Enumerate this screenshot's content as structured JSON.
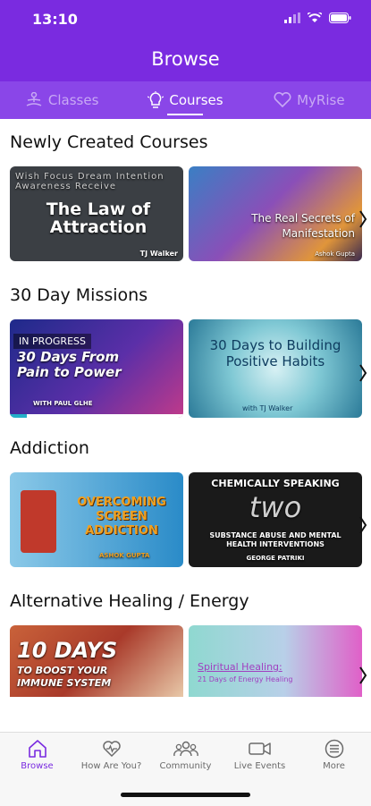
{
  "status": {
    "time": "13:10"
  },
  "header": {
    "title": "Browse"
  },
  "tabs": [
    {
      "label": "Classes",
      "icon": "meditation-icon"
    },
    {
      "label": "Courses",
      "icon": "lightbulb-icon"
    },
    {
      "label": "MyRise",
      "icon": "heart-icon"
    }
  ],
  "sections": [
    {
      "title": "Newly Created Courses",
      "cards": [
        {
          "title": "The Law of Attraction",
          "author": "TJ Walker",
          "extra_words": "Wish Focus Dream Intention Awareness Receive"
        },
        {
          "title": "The Real Secrets of Manifestation",
          "author": "Ashok Gupta"
        }
      ]
    },
    {
      "title": "30 Day Missions",
      "cards": [
        {
          "badge": "IN PROGRESS",
          "title": "30 Days From Pain to Power",
          "author": "WITH PAUL GLHE",
          "progress": 0.1
        },
        {
          "title": "30 Days to Building Positive Habits",
          "author": "with TJ Walker"
        }
      ]
    },
    {
      "title": "Addiction",
      "cards": [
        {
          "title": "OVERCOMING SCREEN ADDICTION",
          "author": "ASHOK GUPTA"
        },
        {
          "title": "CHEMICALLY SPEAKING",
          "subtitle": "two",
          "text2": "SUBSTANCE ABUSE AND MENTAL HEALTH INTERVENTIONS",
          "author": "GEORGE PATRIKI"
        }
      ]
    },
    {
      "title": "Alternative Healing / Energy",
      "cards": [
        {
          "title": "10 DAYS",
          "subtitle": "TO BOOST YOUR IMMUNE SYSTEM"
        },
        {
          "title": "Spiritual Healing:",
          "subtitle": "21 Days of Energy Healing"
        }
      ]
    }
  ],
  "bottom_nav": [
    {
      "label": "Browse",
      "icon": "home-icon"
    },
    {
      "label": "How Are You?",
      "icon": "heart-pulse-icon"
    },
    {
      "label": "Community",
      "icon": "community-icon"
    },
    {
      "label": "Live Events",
      "icon": "video-camera-icon"
    },
    {
      "label": "More",
      "icon": "more-icon"
    }
  ],
  "colors": {
    "brand": "#7a2be0",
    "tabbar": "#8a46e8",
    "progress": "#25b0c8"
  }
}
